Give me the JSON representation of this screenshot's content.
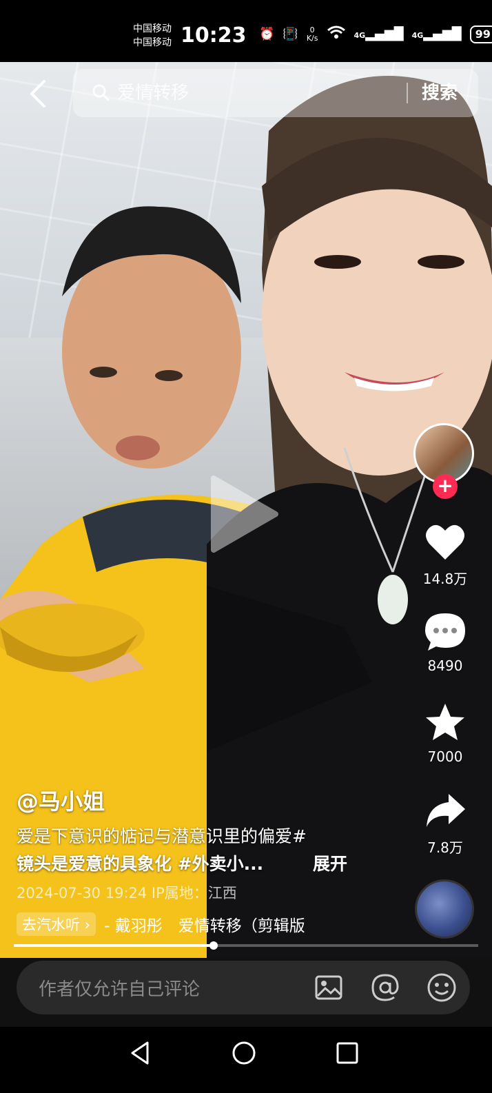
{
  "status_bar": {
    "carrier_1": "中国移动",
    "carrier_2": "中国移动",
    "time": "10:23",
    "net_speed_value": "0",
    "net_speed_unit": "K/s",
    "signal_1": "4G",
    "signal_2": "4G",
    "battery": "99"
  },
  "search": {
    "query": "爱情转移",
    "button_label": "搜索"
  },
  "rail": {
    "likes": "14.8万",
    "comments": "8490",
    "favorites": "7000",
    "shares": "7.8万"
  },
  "post": {
    "author": "@马小姐",
    "description_line1": "爱是下意识的惦记与潜意识里的偏爱#",
    "description_line2": "镜头是爱意的具象化 #外卖小...",
    "expand_label": "展开",
    "meta": "2024-07-30 19:24  IP属地：江西",
    "music_chip": "去汽水听 ›",
    "music_title": "- 戴羽彤　爱情转移（剪辑版"
  },
  "playback": {
    "progress": 0.43
  },
  "comment_bar": {
    "placeholder": "作者仅允许自己评论"
  },
  "icons": {
    "back": "back-arrow-icon",
    "search": "search-icon",
    "like": "heart-icon",
    "comment": "comment-bubble-icon",
    "favorite": "star-icon",
    "share": "share-arrow-icon",
    "image": "image-icon",
    "mention": "at-icon",
    "emoji": "emoji-icon",
    "nav_back": "triangle-back-icon",
    "nav_home": "circle-home-icon",
    "nav_recent": "square-recent-icon"
  },
  "colors": {
    "follow_accent": "#fe2c55",
    "background": "#000000"
  }
}
